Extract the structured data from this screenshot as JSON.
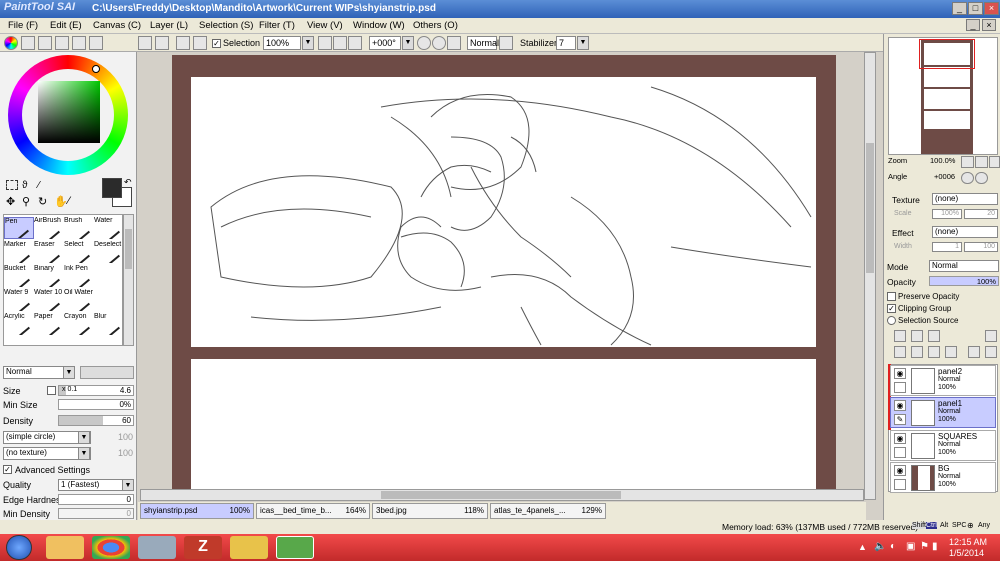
{
  "window": {
    "app_logo": "PaintTool SAI",
    "path": "C:\\Users\\Freddy\\Desktop\\Mandito\\Artwork\\Current WIPs\\shyianstrip.psd"
  },
  "menu": [
    "File (F)",
    "Edit (E)",
    "Canvas (C)",
    "Layer (L)",
    "Selection (S)",
    "Filter (T)",
    "View (V)",
    "Window (W)",
    "Others (O)"
  ],
  "toolbar": {
    "selection_label": "Selection",
    "zoom": "100%",
    "rotation": "+000°",
    "blend": "Normal",
    "stabilizer_label": "Stabilizer",
    "stabilizer_value": "7"
  },
  "tools": [
    {
      "label": "Pen",
      "selected": true
    },
    {
      "label": "AirBrush"
    },
    {
      "label": "Brush"
    },
    {
      "label": "Water"
    },
    {
      "label": "Marker"
    },
    {
      "label": "Eraser"
    },
    {
      "label": "Select"
    },
    {
      "label": "Deselect"
    },
    {
      "label": "Bucket"
    },
    {
      "label": "Binary"
    },
    {
      "label": "Ink Pen"
    },
    {
      "label": ""
    },
    {
      "label": "Water 9"
    },
    {
      "label": "Water 10"
    },
    {
      "label": "Oil Water"
    },
    {
      "label": ""
    },
    {
      "label": "Acrylic"
    },
    {
      "label": "Paper"
    },
    {
      "label": "Crayon"
    },
    {
      "label": "Blur"
    }
  ],
  "brush": {
    "mode": "Normal",
    "size_label": "Size",
    "size_mult": "x 0.1",
    "size_value": "4.6",
    "minsize_label": "Min Size",
    "minsize_value": "0%",
    "density_label": "Density",
    "density_value": "60",
    "density_level": 0.6,
    "shape": "(simple circle)",
    "shape_val": "100",
    "texture": "(no texture)",
    "texture_val": "100",
    "advanced_label": "Advanced Settings",
    "quality_label": "Quality",
    "quality_value": "1 (Fastest)",
    "edge_label": "Edge Hardness",
    "edge_value": "0",
    "mindensity_label": "Min Density",
    "mindensity_value": "0"
  },
  "colors": {
    "foreground": "#2b2b2b",
    "background": "#ffffff",
    "frame": "#6e4b46",
    "accent": "#c8ccff",
    "taskbar": "#d63a3a"
  },
  "doc_tabs": [
    {
      "name": "shyianstrip.psd",
      "zoom": "100%",
      "active": true
    },
    {
      "name": "icas__bed_time_b...",
      "zoom": "164%"
    },
    {
      "name": "3bed.jpg",
      "zoom": "118%"
    },
    {
      "name": "atlas_te_4panels_...",
      "zoom": "129%"
    }
  ],
  "status": {
    "memory": "Memory load: 63% (137MB used / 772MB reserved)",
    "keys": [
      "Shift",
      "Ctrl",
      "Alt",
      "SPC",
      "⊕",
      "Any"
    ]
  },
  "navigator": {
    "zoom_label": "Zoom",
    "zoom_value": "100.0%",
    "angle_label": "Angle",
    "angle_value": "+0006"
  },
  "layer_props": {
    "texture_label": "Texture",
    "texture_value": "(none)",
    "scale_label": "Scale",
    "scale_value": "100%",
    "scale_extra": "20",
    "effect_label": "Effect",
    "effect_value": "(none)",
    "width_label": "Width",
    "width_value": "1",
    "width_extra": "100",
    "mode_label": "Mode",
    "mode_value": "Normal",
    "opacity_label": "Opacity",
    "opacity_value": "100%",
    "preserve_opacity": "Preserve Opacity",
    "clipping_group": "Clipping Group",
    "selection_source": "Selection Source"
  },
  "layers": [
    {
      "name": "panel2",
      "mode": "Normal",
      "opacity": "100%",
      "selected": false
    },
    {
      "name": "panel1",
      "mode": "Normal",
      "opacity": "100%",
      "selected": true
    },
    {
      "name": "SQUARES",
      "mode": "Normal",
      "opacity": "100%",
      "selected": false
    },
    {
      "name": "BG",
      "mode": "Normal",
      "opacity": "100%",
      "selected": false
    }
  ],
  "clock": {
    "time": "12:15 AM",
    "date": "1/5/2014"
  }
}
